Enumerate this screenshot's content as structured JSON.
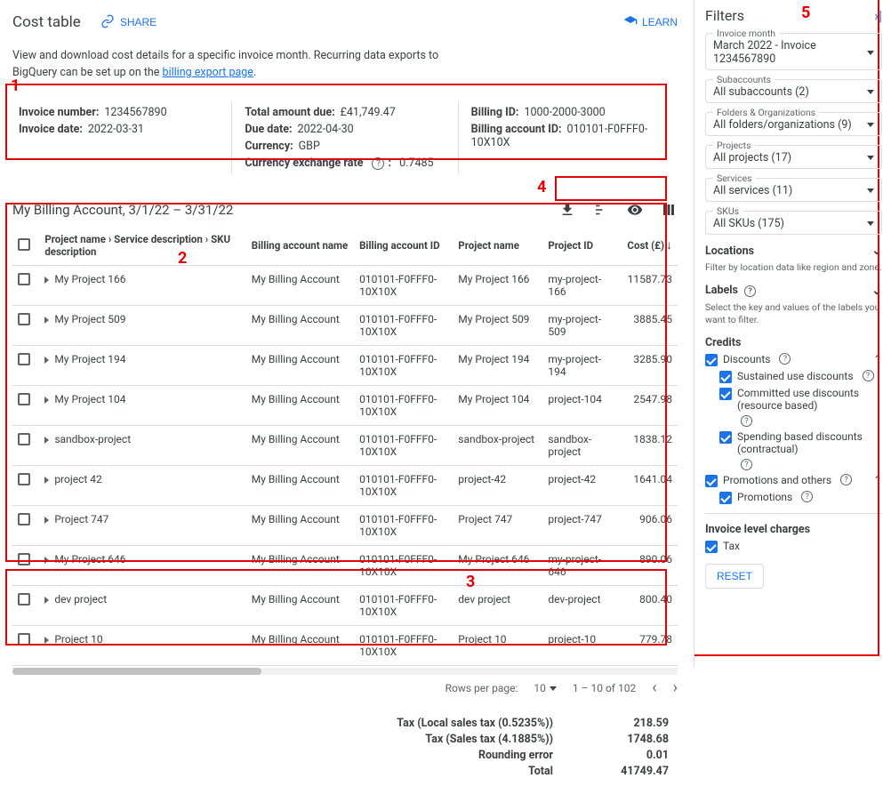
{
  "header": {
    "title": "Cost table",
    "share_label": "SHARE",
    "learn_label": "LEARN"
  },
  "intro": {
    "line1": "View and download cost details for a specific invoice month. Recurring data exports to",
    "line2_prefix": "BigQuery can be set up on the ",
    "link_text": "billing export page",
    "line2_suffix": "."
  },
  "summary": {
    "invoice_number_label": "Invoice number:",
    "invoice_number": "1234567890",
    "invoice_date_label": "Invoice date:",
    "invoice_date": "2022-03-31",
    "total_due_label": "Total amount due:",
    "total_due": "£41,749.47",
    "due_date_label": "Due date:",
    "due_date": "2022-04-30",
    "currency_label": "Currency:",
    "currency": "GBP",
    "fx_label": "Currency exchange rate",
    "fx_value": "0.7485",
    "billing_id_label": "Billing ID:",
    "billing_id": "1000-2000-3000",
    "billing_acct_label": "Billing account ID:",
    "billing_acct": "010101-F0FFF0-10X10X"
  },
  "table": {
    "title": "My Billing Account, 3/1/22 – 3/31/22",
    "columns": {
      "c0": "",
      "c1": "Project name › Service description › SKU description",
      "c2": "Billing account name",
      "c3": "Billing account ID",
      "c4": "Project name",
      "c5": "Project ID",
      "c6": "Cost (£)"
    },
    "rows": [
      {
        "proj": "My Project 166",
        "acct": "My Billing Account",
        "acctid": "010101-F0FFF0-10X10X",
        "pname": "My Project 166",
        "pid": "my-project-166",
        "cost": "11587.73"
      },
      {
        "proj": "My Project 509",
        "acct": "My Billing Account",
        "acctid": "010101-F0FFF0-10X10X",
        "pname": "My Project 509",
        "pid": "my-project-509",
        "cost": "3885.45"
      },
      {
        "proj": "My Project 194",
        "acct": "My Billing Account",
        "acctid": "010101-F0FFF0-10X10X",
        "pname": "My Project 194",
        "pid": "my-project-194",
        "cost": "3285.90"
      },
      {
        "proj": "My Project 104",
        "acct": "My Billing Account",
        "acctid": "010101-F0FFF0-10X10X",
        "pname": "My Project 104",
        "pid": "project-104",
        "cost": "2547.98"
      },
      {
        "proj": "sandbox-project",
        "acct": "My Billing Account",
        "acctid": "010101-F0FFF0-10X10X",
        "pname": "sandbox-project",
        "pid": "sandbox-project",
        "cost": "1838.12"
      },
      {
        "proj": "project 42",
        "acct": "My Billing Account",
        "acctid": "010101-F0FFF0-10X10X",
        "pname": "project-42",
        "pid": "project-42",
        "cost": "1641.04"
      },
      {
        "proj": "Project 747",
        "acct": "My Billing Account",
        "acctid": "010101-F0FFF0-10X10X",
        "pname": "Project 747",
        "pid": "project-747",
        "cost": "906.06"
      },
      {
        "proj": "My Project 646",
        "acct": "My Billing Account",
        "acctid": "010101-F0FFF0-10X10X",
        "pname": "My Project 646",
        "pid": "my-project-646",
        "cost": "890.06"
      },
      {
        "proj": "dev project",
        "acct": "My Billing Account",
        "acctid": "010101-F0FFF0-10X10X",
        "pname": "dev project",
        "pid": "dev-project",
        "cost": "800.40"
      },
      {
        "proj": "Project 10",
        "acct": "My Billing Account",
        "acctid": "010101-F0FFF0-10X10X",
        "pname": "Project 10",
        "pid": "project-10",
        "cost": "779.78"
      }
    ],
    "pager": {
      "rows_label": "Rows per page:",
      "rows_value": "10",
      "range": "1 – 10 of 102"
    }
  },
  "totals": {
    "tax1_label": "Tax (Local sales tax (0.5235%))",
    "tax1_value": "218.59",
    "tax2_label": "Tax (Sales tax (4.1885%))",
    "tax2_value": "1748.68",
    "round_label": "Rounding error",
    "round_value": "0.01",
    "total_label": "Total",
    "total_value": "41749.47"
  },
  "filters": {
    "title": "Filters",
    "invoice_month_label": "Invoice month",
    "invoice_month_value": "March 2022 - Invoice 1234567890",
    "subaccounts_label": "Subaccounts",
    "subaccounts_value": "All subaccounts (2)",
    "folders_label": "Folders & Organizations",
    "folders_value": "All folders/organizations (9)",
    "projects_label": "Projects",
    "projects_value": "All projects (17)",
    "services_label": "Services",
    "services_value": "All services (11)",
    "skus_label": "SKUs",
    "skus_value": "All SKUs (175)",
    "locations_title": "Locations",
    "locations_hint": "Filter by location data like region and zone.",
    "labels_title": "Labels",
    "labels_hint": "Select the key and values of the labels you want to filter.",
    "credits_title": "Credits",
    "discounts": "Discounts",
    "sustained": "Sustained use discounts",
    "committed": "Committed use discounts (resource based)",
    "spending": "Spending based discounts (contractual)",
    "promos_title": "Promotions and others",
    "promos": "Promotions",
    "invoice_charges_title": "Invoice level charges",
    "tax_item": "Tax",
    "reset": "RESET"
  },
  "anno": {
    "n1": "1",
    "n2": "2",
    "n3": "3",
    "n4": "4",
    "n5": "5"
  }
}
